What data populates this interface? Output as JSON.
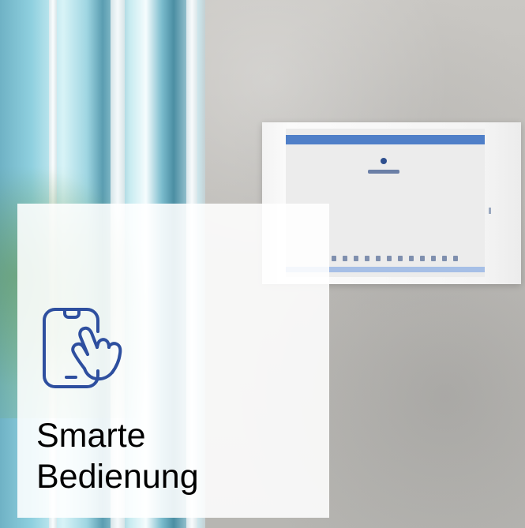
{
  "card": {
    "title_line1": "Smarte",
    "title_line2": "Bedienung",
    "icon": "smartphone-touch-icon",
    "accent_color": "#2e4f9f"
  },
  "photo": {
    "subject": "wall-mounted-control-unit",
    "accent_color": "#4f7fc8"
  }
}
